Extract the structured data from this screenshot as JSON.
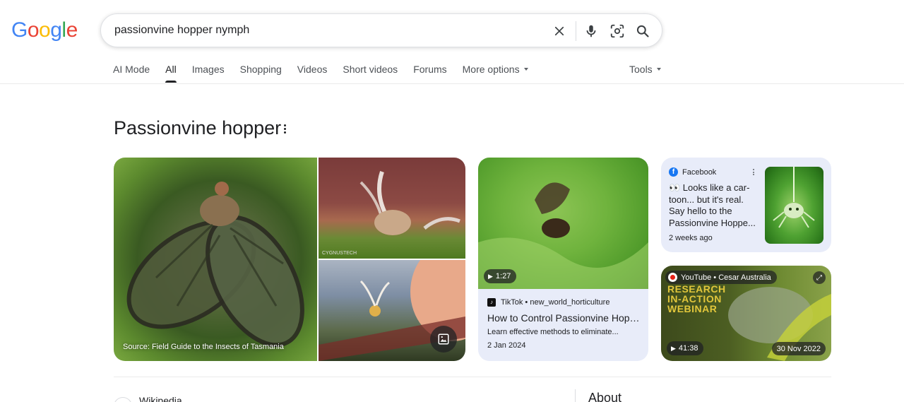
{
  "logo": {
    "text": "Google",
    "letters": [
      "G",
      "o",
      "o",
      "g",
      "l",
      "e"
    ],
    "colors": [
      "#4285F4",
      "#EA4335",
      "#FBBC05",
      "#4285F4",
      "#34A853",
      "#EA4335"
    ]
  },
  "search": {
    "query": "passionvine hopper nymph",
    "icons": [
      "close-icon",
      "mic-icon",
      "lens-icon",
      "search-icon"
    ]
  },
  "tabs": {
    "items": [
      "AI Mode",
      "All",
      "Images",
      "Shopping",
      "Videos",
      "Short videos",
      "Forums",
      "More options"
    ],
    "active": "All",
    "tools": "Tools"
  },
  "knowledge_panel": {
    "title": "Passionvine hopper",
    "image_caption": "Source: Field Guide to the Insects of Tasmania",
    "watermark": "CYGNUSTECH"
  },
  "tiktok_card": {
    "duration": "1:27",
    "source": "TikTok • new_world_horticulture",
    "title": "How to Control Passionvine Hoppe...",
    "description": "Learn effective methods to eliminate...",
    "date": "2 Jan 2024"
  },
  "facebook_card": {
    "source": "Facebook",
    "text_lines": [
      "👀 Looks like a car-",
      "toon... but it's real.",
      "Say hello to the",
      "Passionvine Hoppe..."
    ],
    "time": "2 weeks ago"
  },
  "youtube_card": {
    "source": "YouTube • Cesar Australia",
    "banner_lines": [
      "RESEARCH",
      "IN-ACTION",
      "WEBINAR"
    ],
    "duration": "41:38",
    "date": "30 Nov 2022"
  },
  "bottom": {
    "source_name": "Wikipedia",
    "about": "About"
  },
  "colors": {
    "card_bg": "#e8ecf9",
    "text": "#202124",
    "muted": "#4d5156"
  }
}
